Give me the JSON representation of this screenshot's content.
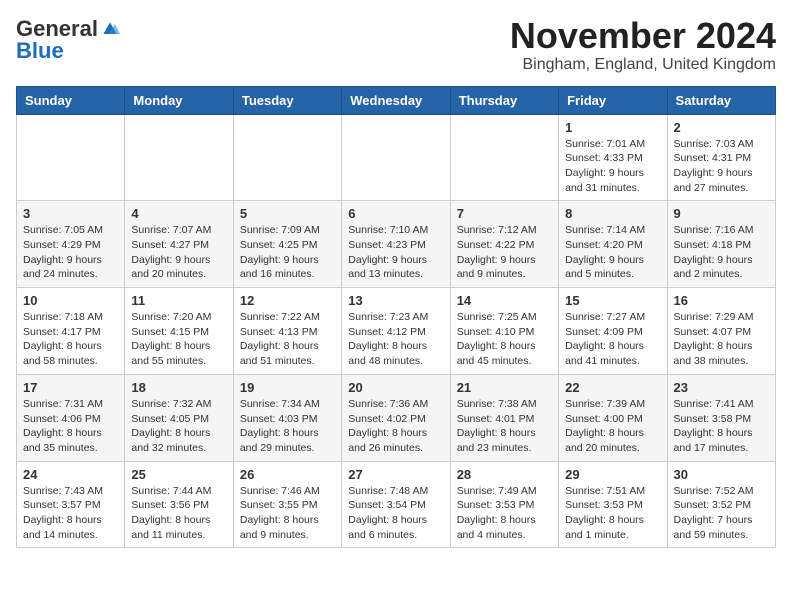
{
  "header": {
    "logo": {
      "general": "General",
      "blue": "Blue"
    },
    "title": "November 2024",
    "location": "Bingham, England, United Kingdom"
  },
  "weekdays": [
    "Sunday",
    "Monday",
    "Tuesday",
    "Wednesday",
    "Thursday",
    "Friday",
    "Saturday"
  ],
  "weeks": [
    [
      {
        "day": "",
        "info": ""
      },
      {
        "day": "",
        "info": ""
      },
      {
        "day": "",
        "info": ""
      },
      {
        "day": "",
        "info": ""
      },
      {
        "day": "",
        "info": ""
      },
      {
        "day": "1",
        "info": "Sunrise: 7:01 AM\nSunset: 4:33 PM\nDaylight: 9 hours\nand 31 minutes."
      },
      {
        "day": "2",
        "info": "Sunrise: 7:03 AM\nSunset: 4:31 PM\nDaylight: 9 hours\nand 27 minutes."
      }
    ],
    [
      {
        "day": "3",
        "info": "Sunrise: 7:05 AM\nSunset: 4:29 PM\nDaylight: 9 hours\nand 24 minutes."
      },
      {
        "day": "4",
        "info": "Sunrise: 7:07 AM\nSunset: 4:27 PM\nDaylight: 9 hours\nand 20 minutes."
      },
      {
        "day": "5",
        "info": "Sunrise: 7:09 AM\nSunset: 4:25 PM\nDaylight: 9 hours\nand 16 minutes."
      },
      {
        "day": "6",
        "info": "Sunrise: 7:10 AM\nSunset: 4:23 PM\nDaylight: 9 hours\nand 13 minutes."
      },
      {
        "day": "7",
        "info": "Sunrise: 7:12 AM\nSunset: 4:22 PM\nDaylight: 9 hours\nand 9 minutes."
      },
      {
        "day": "8",
        "info": "Sunrise: 7:14 AM\nSunset: 4:20 PM\nDaylight: 9 hours\nand 5 minutes."
      },
      {
        "day": "9",
        "info": "Sunrise: 7:16 AM\nSunset: 4:18 PM\nDaylight: 9 hours\nand 2 minutes."
      }
    ],
    [
      {
        "day": "10",
        "info": "Sunrise: 7:18 AM\nSunset: 4:17 PM\nDaylight: 8 hours\nand 58 minutes."
      },
      {
        "day": "11",
        "info": "Sunrise: 7:20 AM\nSunset: 4:15 PM\nDaylight: 8 hours\nand 55 minutes."
      },
      {
        "day": "12",
        "info": "Sunrise: 7:22 AM\nSunset: 4:13 PM\nDaylight: 8 hours\nand 51 minutes."
      },
      {
        "day": "13",
        "info": "Sunrise: 7:23 AM\nSunset: 4:12 PM\nDaylight: 8 hours\nand 48 minutes."
      },
      {
        "day": "14",
        "info": "Sunrise: 7:25 AM\nSunset: 4:10 PM\nDaylight: 8 hours\nand 45 minutes."
      },
      {
        "day": "15",
        "info": "Sunrise: 7:27 AM\nSunset: 4:09 PM\nDaylight: 8 hours\nand 41 minutes."
      },
      {
        "day": "16",
        "info": "Sunrise: 7:29 AM\nSunset: 4:07 PM\nDaylight: 8 hours\nand 38 minutes."
      }
    ],
    [
      {
        "day": "17",
        "info": "Sunrise: 7:31 AM\nSunset: 4:06 PM\nDaylight: 8 hours\nand 35 minutes."
      },
      {
        "day": "18",
        "info": "Sunrise: 7:32 AM\nSunset: 4:05 PM\nDaylight: 8 hours\nand 32 minutes."
      },
      {
        "day": "19",
        "info": "Sunrise: 7:34 AM\nSunset: 4:03 PM\nDaylight: 8 hours\nand 29 minutes."
      },
      {
        "day": "20",
        "info": "Sunrise: 7:36 AM\nSunset: 4:02 PM\nDaylight: 8 hours\nand 26 minutes."
      },
      {
        "day": "21",
        "info": "Sunrise: 7:38 AM\nSunset: 4:01 PM\nDaylight: 8 hours\nand 23 minutes."
      },
      {
        "day": "22",
        "info": "Sunrise: 7:39 AM\nSunset: 4:00 PM\nDaylight: 8 hours\nand 20 minutes."
      },
      {
        "day": "23",
        "info": "Sunrise: 7:41 AM\nSunset: 3:58 PM\nDaylight: 8 hours\nand 17 minutes."
      }
    ],
    [
      {
        "day": "24",
        "info": "Sunrise: 7:43 AM\nSunset: 3:57 PM\nDaylight: 8 hours\nand 14 minutes."
      },
      {
        "day": "25",
        "info": "Sunrise: 7:44 AM\nSunset: 3:56 PM\nDaylight: 8 hours\nand 11 minutes."
      },
      {
        "day": "26",
        "info": "Sunrise: 7:46 AM\nSunset: 3:55 PM\nDaylight: 8 hours\nand 9 minutes."
      },
      {
        "day": "27",
        "info": "Sunrise: 7:48 AM\nSunset: 3:54 PM\nDaylight: 8 hours\nand 6 minutes."
      },
      {
        "day": "28",
        "info": "Sunrise: 7:49 AM\nSunset: 3:53 PM\nDaylight: 8 hours\nand 4 minutes."
      },
      {
        "day": "29",
        "info": "Sunrise: 7:51 AM\nSunset: 3:53 PM\nDaylight: 8 hours\nand 1 minute."
      },
      {
        "day": "30",
        "info": "Sunrise: 7:52 AM\nSunset: 3:52 PM\nDaylight: 7 hours\nand 59 minutes."
      }
    ]
  ]
}
